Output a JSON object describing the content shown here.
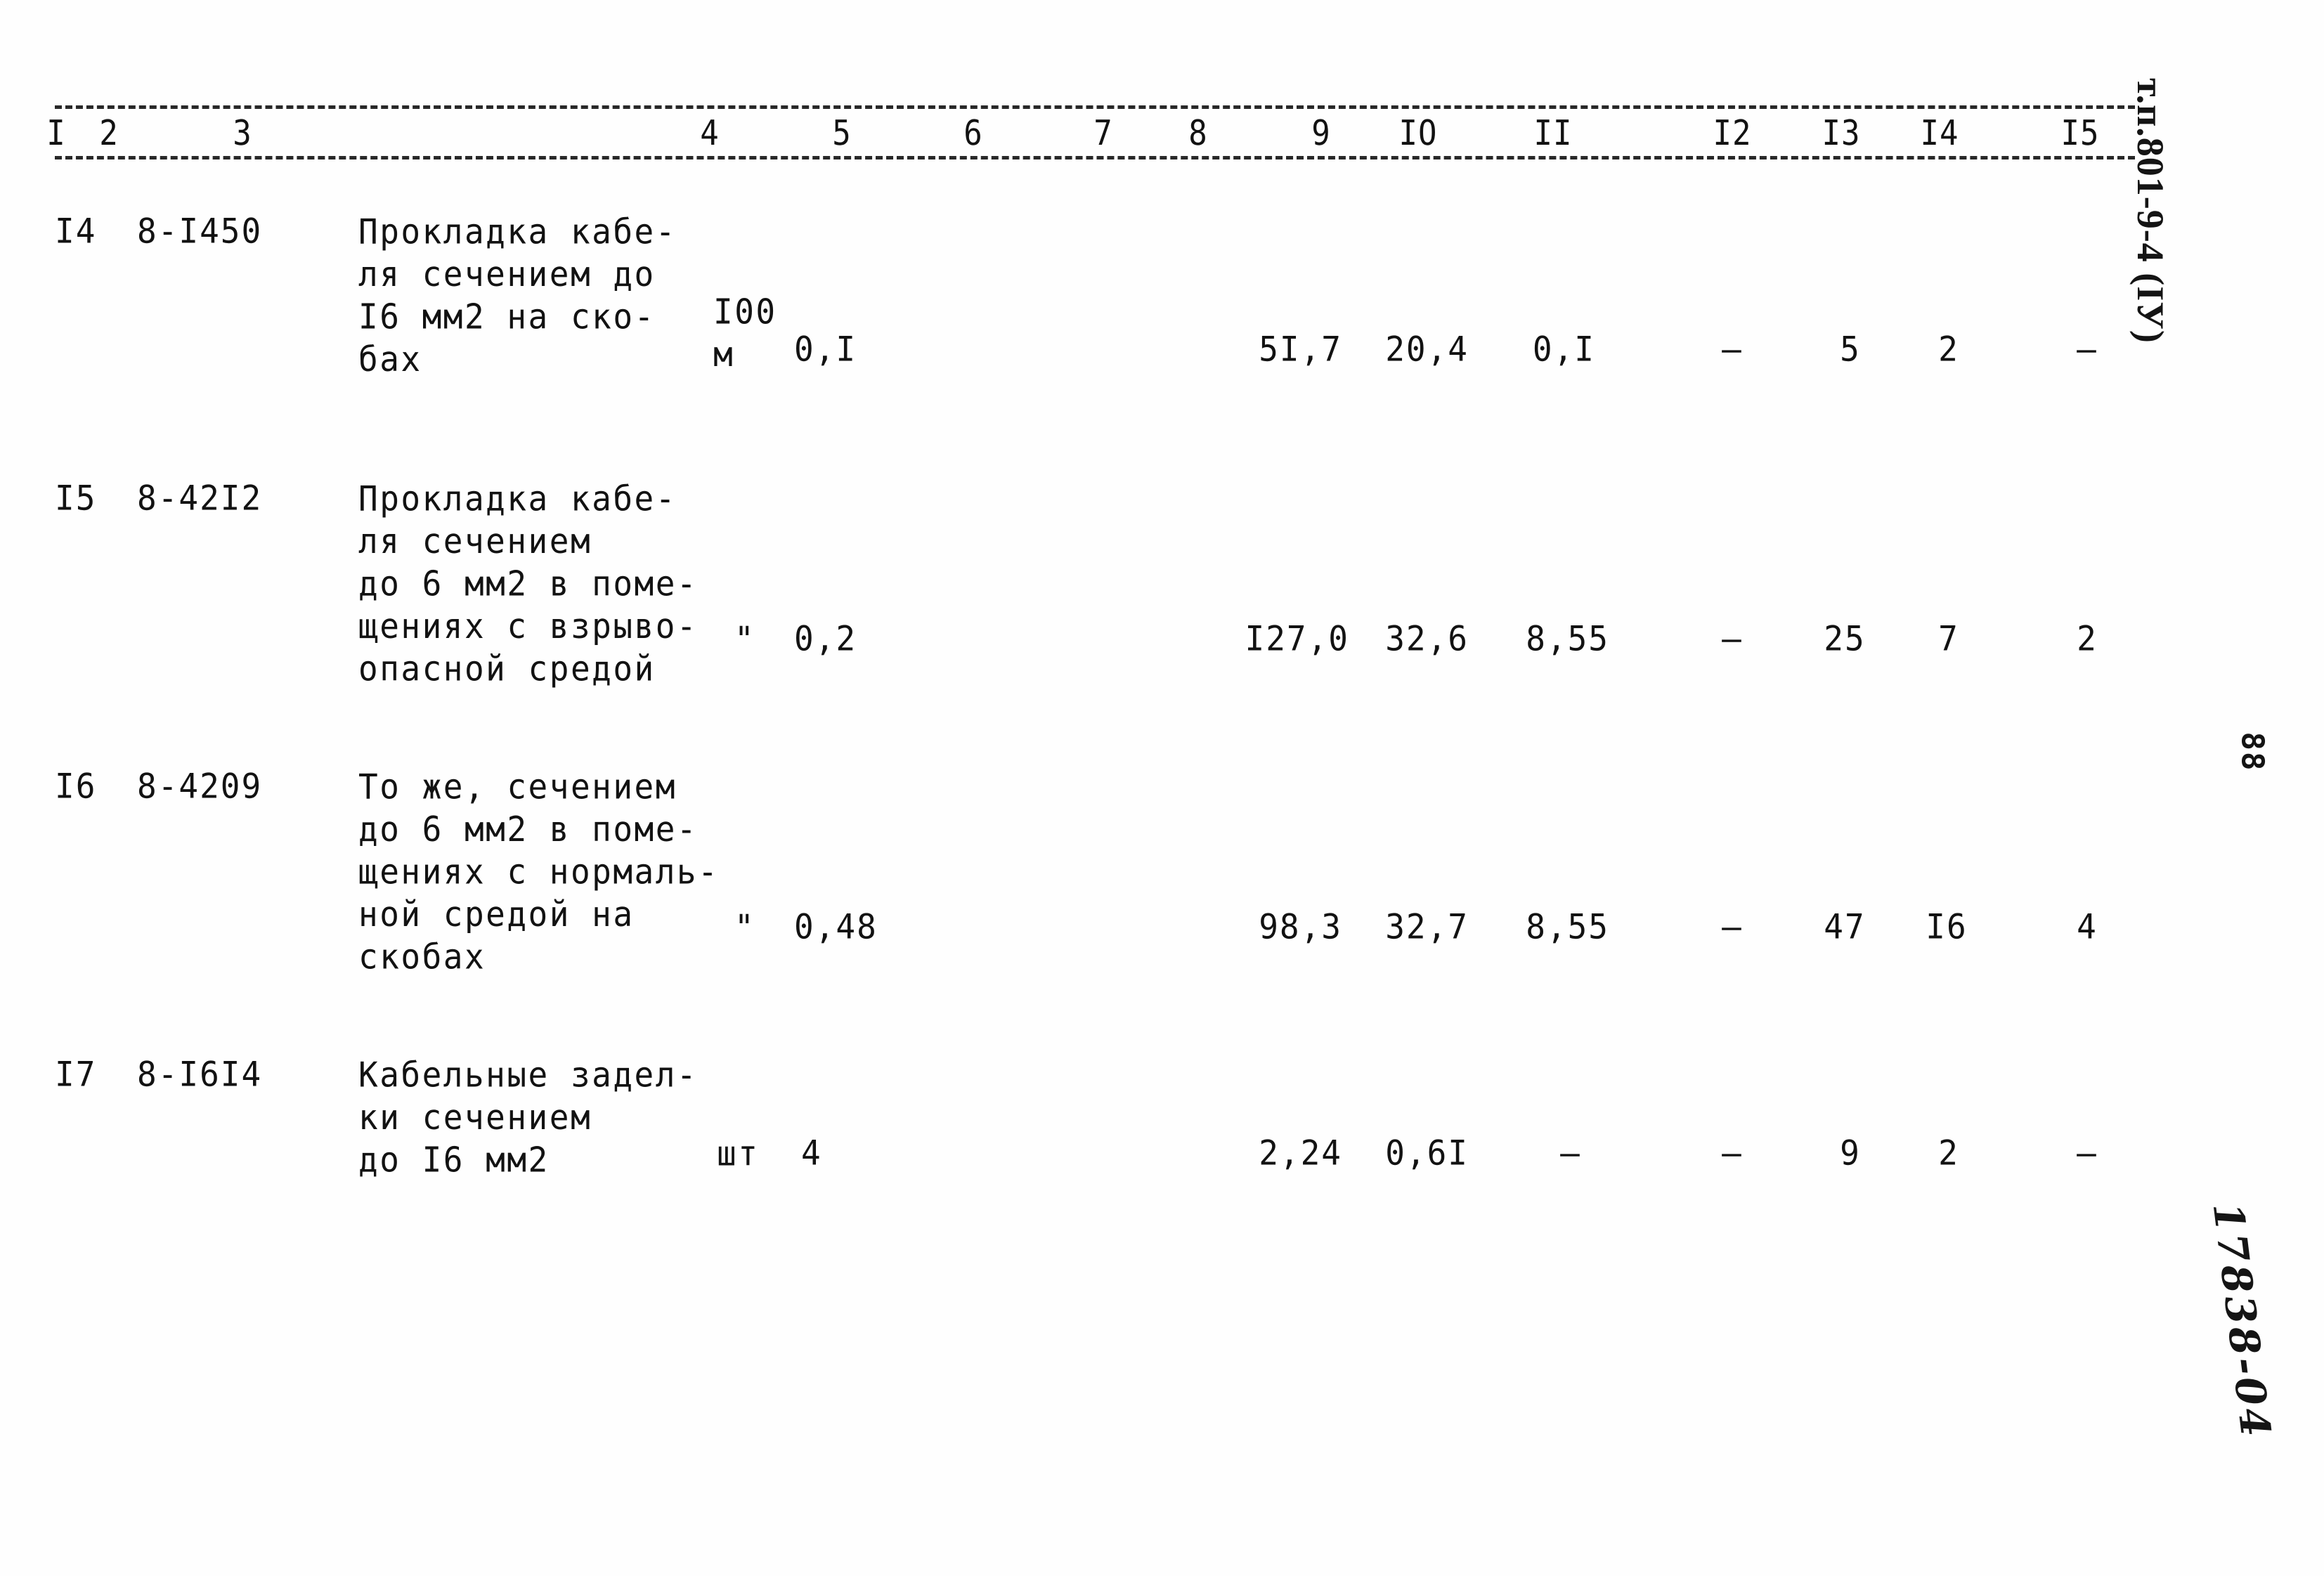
{
  "document": {
    "kind": "scanned-estimate-table",
    "page_number": "88",
    "margin_stamp": "т.п.801-9-4 (IУ)",
    "margin_handwritten": "17838-04"
  },
  "table": {
    "column_headers": [
      "I",
      "2",
      "3",
      "4",
      "5",
      "6",
      "7",
      "8",
      "9",
      "IO",
      "II",
      "I2",
      "I3",
      "I4",
      "I5"
    ],
    "rows": [
      {
        "c1": "I4",
        "c2": "8-I450",
        "c3": "Прокладка кабе-\nля сечением до\nI6 мм2 на ско-\nбах",
        "c4": "I00\nм",
        "c5": "0,I",
        "c6": "",
        "c7": "",
        "c8": "",
        "c9": "5I,7",
        "c10": "20,4",
        "c11": "0,I",
        "c12": "–",
        "c13": "5",
        "c14": "2",
        "c15": "–"
      },
      {
        "c1": "I5",
        "c2": "8-42I2",
        "c3": "Прокладка кабе-\nля сечением\nдо 6 мм2 в поме-\nщениях с взрыво-\nопасной средой",
        "c4": "\"",
        "c5": "0,2",
        "c6": "",
        "c7": "",
        "c8": "",
        "c9": "I27,0",
        "c10": "32,6",
        "c11": "8,55",
        "c12": "–",
        "c13": "25",
        "c14": "7",
        "c15": "2"
      },
      {
        "c1": "I6",
        "c2": "8-4209",
        "c3": "То же, сечением\nдо 6 мм2 в поме-\nщениях с нормаль-\nной средой на\nскобах",
        "c4": "\"",
        "c5": "0,48",
        "c6": "",
        "c7": "",
        "c8": "",
        "c9": "98,3",
        "c10": "32,7",
        "c11": "8,55",
        "c12": "–",
        "c13": "47",
        "c14": "I6",
        "c15": "4"
      },
      {
        "c1": "I7",
        "c2": "8-I6I4",
        "c3": "Кабельные задел-\nки сечением\nдо I6 мм2",
        "c4": "шт",
        "c5": "4",
        "c6": "",
        "c7": "",
        "c8": "",
        "c9": "2,24",
        "c10": "0,6I",
        "c11": "–",
        "c12": "–",
        "c13": "9",
        "c14": "2",
        "c15": "–"
      }
    ]
  }
}
